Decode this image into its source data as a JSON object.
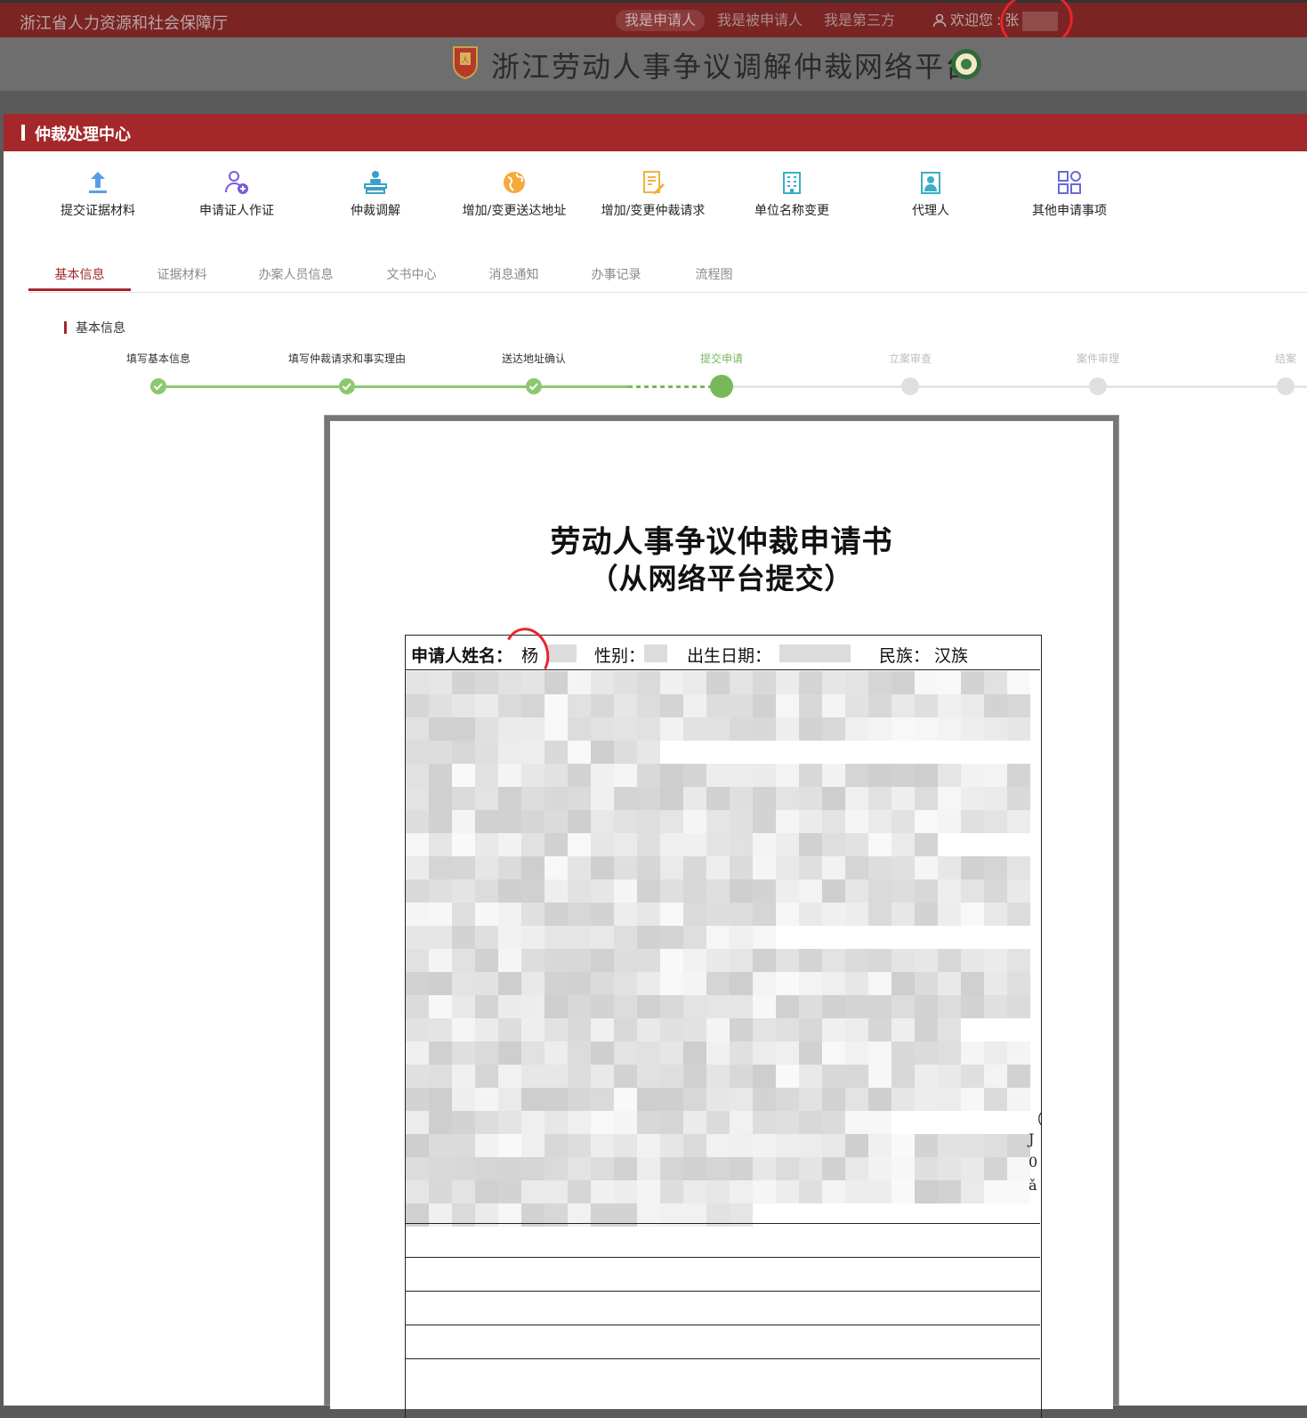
{
  "topbar": {
    "org": "浙江省人力资源和社会保障厅",
    "roles": [
      "我是申请人",
      "我是被申请人",
      "我是第三方"
    ],
    "welcome": "欢迎您",
    "user_initial": "张"
  },
  "header": {
    "title": "浙江劳动人事争议调解仲裁网络平台"
  },
  "panel": {
    "title": "仲裁处理中心"
  },
  "tools": [
    {
      "label": "提交证据材料",
      "icon": "upload-icon"
    },
    {
      "label": "申请证人作证",
      "icon": "witness-add-icon"
    },
    {
      "label": "仲裁调解",
      "icon": "mediation-icon"
    },
    {
      "label": "增加/变更送达地址",
      "icon": "globe-icon"
    },
    {
      "label": "增加/变更仲裁请求",
      "icon": "edit-document-icon"
    },
    {
      "label": "单位名称变更",
      "icon": "building-icon"
    },
    {
      "label": "代理人",
      "icon": "agent-icon"
    },
    {
      "label": "其他申请事项",
      "icon": "grid-icon"
    }
  ],
  "tabs": [
    "基本信息",
    "证据材料",
    "办案人员信息",
    "文书中心",
    "消息通知",
    "办事记录",
    "流程图"
  ],
  "active_tab": "基本信息",
  "section_title": "基本信息",
  "steps": [
    {
      "label": "填写基本信息",
      "state": "done"
    },
    {
      "label": "填写仲裁请求和事实理由",
      "state": "done"
    },
    {
      "label": "送达地址确认",
      "state": "done"
    },
    {
      "label": "提交申请",
      "state": "current"
    },
    {
      "label": "立案审查",
      "state": "future"
    },
    {
      "label": "案件审理",
      "state": "future"
    },
    {
      "label": "结案",
      "state": "future"
    }
  ],
  "document": {
    "title": "劳动人事争议仲裁申请书",
    "subtitle": "（从网络平台提交）",
    "fields": {
      "name_label": "申请人姓名：",
      "name_value": "杨",
      "gender_label": "性别：",
      "birth_label": "出生日期：",
      "ethnicity_label": "民族：",
      "ethnicity_value": "汉族"
    },
    "edge_fragments": [
      "（",
      "J",
      "0",
      "ǎ"
    ]
  },
  "colors": {
    "topbar": "#7a2524",
    "panel_header": "#a4282a",
    "accent_red": "#a4282a",
    "step_done": "#8cc870",
    "step_current": "#79b85a",
    "step_future": "#e0e0e0",
    "annotation": "#e8252c"
  }
}
